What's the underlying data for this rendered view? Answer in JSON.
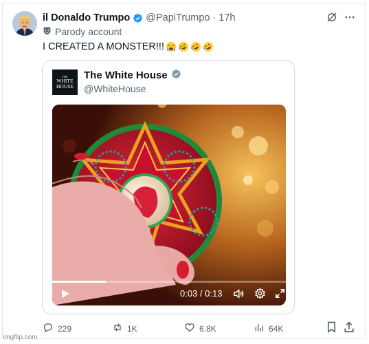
{
  "post": {
    "display_name": "il Donaldo Trumpo",
    "handle": "@PapiTrumpo",
    "separator": "·",
    "time": "17h",
    "parody_label": "Parody account",
    "text": "I CREATED A MONSTER!!!"
  },
  "quote": {
    "logo_line1": "THE",
    "logo_line2": "WHITE",
    "logo_line3": "HOUSE",
    "name": "The White House",
    "handle": "@WhiteHouse",
    "video": {
      "time_display": "0:03 / 0:13",
      "progress": 0.23
    }
  },
  "actions": {
    "replies": "229",
    "reposts": "1K",
    "likes": "6.8K",
    "views": "64K"
  },
  "watermark": "imgflip.com",
  "colors": {
    "verified_blue": "#1d9bf0",
    "secondary_text": "#536471",
    "border": "#cfd9de"
  },
  "icons": [
    "verified-badge-icon",
    "grok-icon",
    "more-icon",
    "parody-mask-icon",
    "crying-emoji-icon",
    "rofl-emoji-icon",
    "play-icon",
    "volume-icon",
    "settings-icon",
    "fullscreen-icon",
    "reply-icon",
    "repost-icon",
    "like-icon",
    "views-icon",
    "bookmark-icon",
    "share-icon"
  ]
}
